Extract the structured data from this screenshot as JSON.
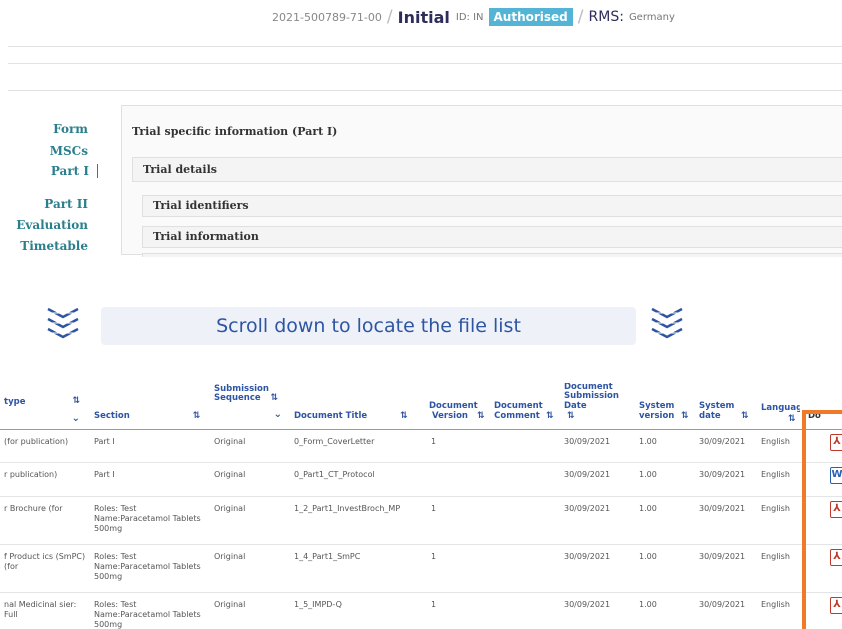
{
  "header": {
    "code": "2021-500789-71-00",
    "phase": "Initial",
    "id_label": "ID: IN",
    "status": "Authorised",
    "rms_label": "RMS:",
    "rms_value": "Germany"
  },
  "nav": {
    "items": [
      "Form",
      "MSCs",
      "Part I",
      "Part II",
      "Evaluation",
      "Timetable"
    ],
    "active": "Part I"
  },
  "panels": {
    "trial_specific": "Trial specific information (Part I)",
    "trial_details": "Trial details",
    "trial_identifiers": "Trial identifiers",
    "trial_information": "Trial information"
  },
  "banner": {
    "text": "Scroll down to locate the file list"
  },
  "table": {
    "headers": {
      "type": "type",
      "section": "Section",
      "sequence": "Submission Sequence",
      "title": "Document Title",
      "version": "Document Version",
      "comment": "Document Comment",
      "subdate": "Document Submission Date",
      "sysver": "System version",
      "sysdate": "System date",
      "language": "Language",
      "doc": "Do"
    },
    "rows": [
      {
        "type": "(for publication)",
        "section": "Part I",
        "sequence": "Original",
        "title": "0_Form_CoverLetter",
        "version": "1",
        "subdate": "30/09/2021",
        "sysver": "1.00",
        "sysdate": "30/09/2021",
        "language": "English",
        "icon": "pdf-icon"
      },
      {
        "type": "r publication)",
        "section": "Part I",
        "sequence": "Original",
        "title": "0_Part1_CT_Protocol",
        "version": "",
        "subdate": "30/09/2021",
        "sysver": "1.00",
        "sysdate": "30/09/2021",
        "language": "English",
        "icon": "word-icon"
      },
      {
        "type": "r Brochure (for",
        "section": "Roles: Test Name:Paracetamol Tablets 500mg",
        "sequence": "Original",
        "title": "1_2_Part1_InvestBroch_MP",
        "version": "1",
        "subdate": "30/09/2021",
        "sysver": "1.00",
        "sysdate": "30/09/2021",
        "language": "English",
        "icon": "pdf-icon"
      },
      {
        "type": "f Product ics (SmPC) (for",
        "section": "Roles: Test Name:Paracetamol Tablets 500mg",
        "sequence": "Original",
        "title": "1_4_Part1_SmPC",
        "version": "1",
        "subdate": "30/09/2021",
        "sysver": "1.00",
        "sysdate": "30/09/2021",
        "language": "English",
        "icon": "pdf-icon"
      },
      {
        "type": "nal Medicinal sier: Full",
        "section": "Roles: Test Name:Paracetamol Tablets 500mg",
        "sequence": "Original",
        "title": "1_5_IMPD-Q",
        "version": "1",
        "subdate": "30/09/2021",
        "sysver": "1.00",
        "sysdate": "30/09/2021",
        "language": "English",
        "icon": "pdf-icon"
      }
    ]
  },
  "colors": {
    "accent": "#2a7f8c",
    "link": "#2e55a3",
    "badge": "#53b4d6",
    "highlight": "#ef7a2a",
    "pdf": "#c0392b",
    "word": "#2b5fb3"
  }
}
